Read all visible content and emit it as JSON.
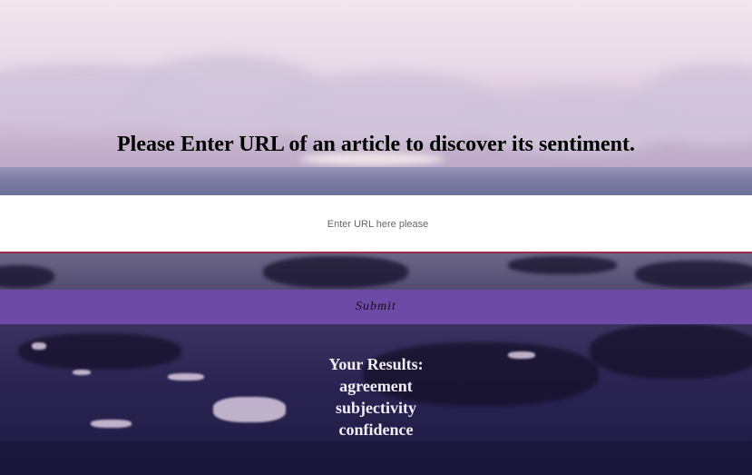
{
  "heading": "Please Enter URL of an article to discover its sentiment.",
  "url_input": {
    "placeholder": "Enter URL here please",
    "value": ""
  },
  "submit_label": "Submit",
  "results": {
    "title": "Your Results:",
    "items": [
      "agreement",
      "subjectivity",
      "confidence"
    ]
  },
  "colors": {
    "accent": "#6c4aa6",
    "input_border": "#9e2b4a"
  }
}
